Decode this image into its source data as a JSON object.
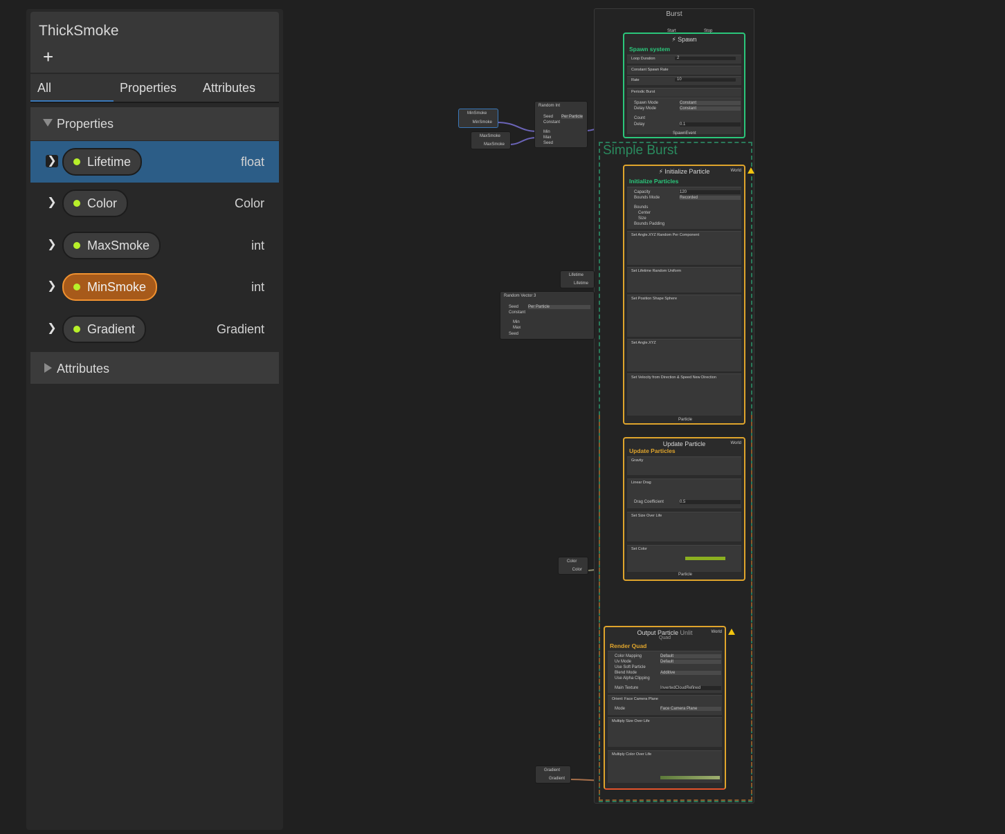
{
  "blackboard": {
    "title": "ThickSmoke",
    "add_label": "+",
    "tabs": [
      "All",
      "Properties",
      "Attributes"
    ],
    "properties_category": "Properties",
    "attributes_category": "Attributes",
    "properties": [
      {
        "name": "Lifetime",
        "type": "float",
        "selected": true
      },
      {
        "name": "Color",
        "type": "Color"
      },
      {
        "name": "MaxSmoke",
        "type": "int"
      },
      {
        "name": "MinSmoke",
        "type": "int",
        "highlighted": true
      },
      {
        "name": "Gradient",
        "type": "Gradient"
      }
    ]
  },
  "graph": {
    "system_name": "Burst",
    "sticky_title": "Simple Burst",
    "spawn": {
      "title": "Spawn",
      "port_start": "Start",
      "port_stop": "Stop",
      "subtitle": "Spawn system",
      "loop_label": "Loop Duration",
      "loop_value": "2",
      "block1": "Constant Spawn Rate",
      "rate_label": "Rate",
      "rate_value": "10",
      "block2": "Periodic Burst",
      "spawn_mode": "Spawn Mode",
      "spawn_mode_value": "Constant",
      "delay_mode": "Delay Mode",
      "delay_mode_value": "Constant",
      "count_label": "Count",
      "delay_label": "Delay",
      "delay_value": "0.1",
      "out": "SpawnEvent"
    },
    "init": {
      "title": "Initialize Particle",
      "space": "World",
      "subtitle": "Initialize Particles",
      "rows": [
        "Capacity",
        "Bounds Mode",
        "Bounds",
        "Center",
        "Size",
        "Bounds Padding"
      ],
      "capacity_value": "120",
      "bounds_mode_value": "Recorded",
      "blocks": [
        "Set  Angle.XYZ  Random Per Component",
        "Set  Lifetime  Random Uniform",
        "Set  Position Shape  Sphere",
        "Set  Angle.XYZ",
        "Set  Velocity from Direction & Speed  New Direction"
      ],
      "out": "Particle"
    },
    "update": {
      "title": "Update Particle",
      "space": "World",
      "subtitle": "Update Particles",
      "blocks": [
        "Gravity",
        "Linear Drag",
        "Set  Size  Over Life",
        "Set  Color"
      ],
      "drag_label": "Drag Coefficient",
      "drag_value": "0.5",
      "out": "Particle"
    },
    "output": {
      "title": "Output Particle",
      "title_suffix": "Unlit",
      "subtitle2": "Quad",
      "space": "World",
      "subtitle": "Render Quad",
      "rows": [
        "Color Mapping",
        "Uv Mode",
        "Use Soft Particle",
        "Blend Mode",
        "Use Alpha Clipping"
      ],
      "values": [
        "Default",
        "Default",
        "",
        "Additive",
        ""
      ],
      "main_texture": "Main Texture",
      "texture_value": "InvertedCloudRefined",
      "blocks": [
        "Orient: Face Camera Plane",
        "Multiply  Size  Over Life",
        "Multiply  Color  Over Life"
      ],
      "mode_label": "Mode",
      "mode_value": "Face Camera Plane"
    },
    "operators": {
      "minsmoke": {
        "title": "MinSmoke",
        "out": "MinSmoke"
      },
      "maxsmoke": {
        "title": "MaxSmoke",
        "out": "MaxSmoke"
      },
      "random_int": {
        "title": "Random",
        "type": "Int",
        "seed": "Seed",
        "seed_value": "Per Particle",
        "constant": "Constant",
        "min": "Min",
        "max": "Max",
        "seed2": "Seed"
      },
      "lifetime": {
        "title": "Lifetime",
        "out": "Lifetime"
      },
      "random_vec": {
        "title": "Random",
        "type": "Vector 3",
        "seed": "Seed",
        "seed_value": "Per Particle",
        "constant": "Constant",
        "min": "Min",
        "max": "Max",
        "seed2": "Seed"
      },
      "color": {
        "title": "Color",
        "out": "Color"
      },
      "gradient": {
        "title": "Gradient",
        "out": "Gradient"
      }
    }
  },
  "colors": {
    "accent": "#3a79bb",
    "selected_row": "#2c5d87",
    "highlight_orange": "#f19230",
    "spawn_green": "#2bc77b",
    "particle_orange": "#e0a52c",
    "property_dot": "#b8f02a"
  }
}
